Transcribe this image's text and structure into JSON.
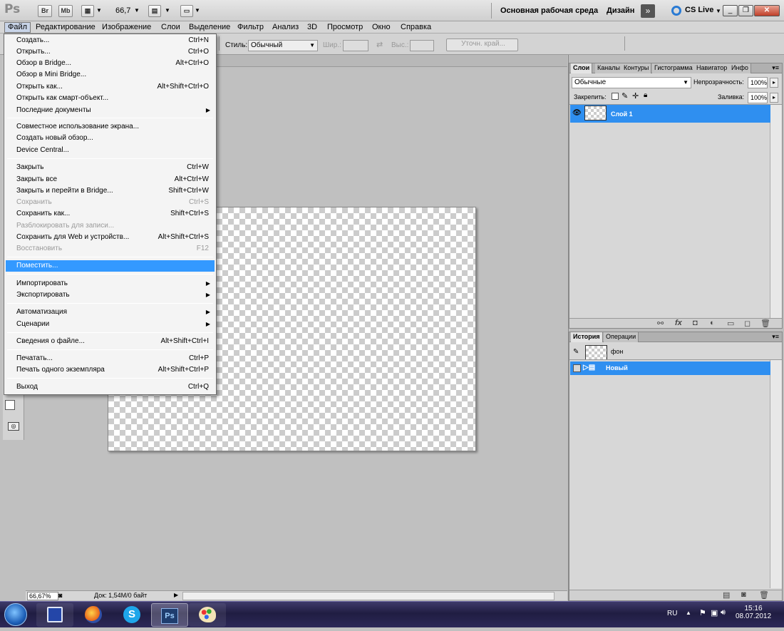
{
  "appbar": {
    "logo": "Ps",
    "br": "Br",
    "mb": "Mb",
    "zoom": "66,7",
    "workspace": "Основная рабочая среда",
    "design": "Дизайн",
    "more": "»",
    "cslive": "CS Live",
    "win_min": "_",
    "win_max": "❐",
    "win_close": "✕"
  },
  "menubar": [
    "Файл",
    "Редактирование",
    "Изображение",
    "Слои",
    "Выделение",
    "Фильтр",
    "Анализ",
    "3D",
    "Просмотр",
    "Окно",
    "Справка"
  ],
  "options": {
    "style_label": "Стиль:",
    "style_value": "Обычный",
    "width_label": "Шир.:",
    "height_label": "Выс.:",
    "refine_button": "Уточн. край..."
  },
  "file_menu": {
    "items": [
      {
        "label": "Создать...",
        "shortcut": "Ctrl+N"
      },
      {
        "label": "Открыть...",
        "shortcut": "Ctrl+O"
      },
      {
        "label": "Обзор в Bridge...",
        "shortcut": "Alt+Ctrl+O"
      },
      {
        "label": "Обзор в Mini Bridge...",
        "shortcut": ""
      },
      {
        "label": "Открыть как...",
        "shortcut": "Alt+Shift+Ctrl+O"
      },
      {
        "label": "Открыть как смарт-объект...",
        "shortcut": ""
      },
      {
        "label": "Последние документы",
        "shortcut": ""
      },
      {
        "label": "Совместное использование экрана...",
        "shortcut": ""
      },
      {
        "label": "Создать новый обзор...",
        "shortcut": ""
      },
      {
        "label": "Device Central...",
        "shortcut": ""
      },
      {
        "label": "Закрыть",
        "shortcut": "Ctrl+W"
      },
      {
        "label": "Закрыть все",
        "shortcut": "Alt+Ctrl+W"
      },
      {
        "label": "Закрыть и перейти в Bridge...",
        "shortcut": "Shift+Ctrl+W"
      },
      {
        "label": "Сохранить",
        "shortcut": "Ctrl+S"
      },
      {
        "label": "Сохранить как...",
        "shortcut": "Shift+Ctrl+S"
      },
      {
        "label": "Разблокировать для записи...",
        "shortcut": ""
      },
      {
        "label": "Сохранить для Web и устройств...",
        "shortcut": "Alt+Shift+Ctrl+S"
      },
      {
        "label": "Восстановить",
        "shortcut": "F12"
      },
      {
        "label": "Поместить...",
        "shortcut": ""
      },
      {
        "label": "Импортировать",
        "shortcut": ""
      },
      {
        "label": "Экспортировать",
        "shortcut": ""
      },
      {
        "label": "Автоматизация",
        "shortcut": ""
      },
      {
        "label": "Сценарии",
        "shortcut": ""
      },
      {
        "label": "Сведения о файле...",
        "shortcut": "Alt+Shift+Ctrl+I"
      },
      {
        "label": "Печатать...",
        "shortcut": "Ctrl+P"
      },
      {
        "label": "Печать одного экземпляра",
        "shortcut": "Alt+Shift+Ctrl+P"
      },
      {
        "label": "Выход",
        "shortcut": "Ctrl+Q"
      }
    ]
  },
  "layers_panel": {
    "tabs": [
      "Слои",
      "Каналы",
      "Контуры",
      "Гистограмма",
      "Навигатор",
      "Инфо"
    ],
    "blend_mode": "Обычные",
    "opacity_label": "Непрозрачность:",
    "opacity_value": "100%",
    "lock_label": "Закрепить:",
    "fill_label": "Заливка:",
    "fill_value": "100%",
    "layer_name": "Слой 1"
  },
  "history_panel": {
    "tabs": [
      "История",
      "Операции"
    ],
    "snapshot": "фон",
    "state": "Новый"
  },
  "status": {
    "zoom": "66,67%",
    "doc": "Док: 1,54M/0 байт"
  },
  "taskbar": {
    "lang": "RU",
    "time": "15:16",
    "date": "08.07.2012",
    "ps_label": "Ps"
  }
}
